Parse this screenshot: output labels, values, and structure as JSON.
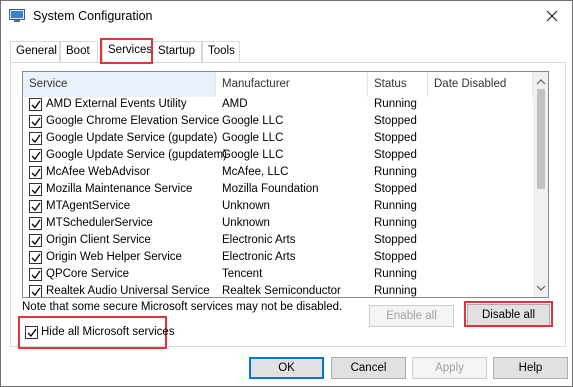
{
  "window": {
    "title": "System Configuration"
  },
  "tabs": [
    "General",
    "Boot",
    "Services",
    "Startup",
    "Tools"
  ],
  "active_tab": "Services",
  "table": {
    "columns": [
      "Service",
      "Manufacturer",
      "Status",
      "Date Disabled"
    ],
    "rows": [
      {
        "service": "AMD External Events Utility",
        "manufacturer": "AMD",
        "status": "Running",
        "checked": true
      },
      {
        "service": "Google Chrome Elevation Service",
        "manufacturer": "Google LLC",
        "status": "Stopped",
        "checked": true
      },
      {
        "service": "Google Update Service (gupdate)",
        "manufacturer": "Google LLC",
        "status": "Stopped",
        "checked": true
      },
      {
        "service": "Google Update Service (gupdatem)",
        "manufacturer": "Google LLC",
        "status": "Stopped",
        "checked": true
      },
      {
        "service": "McAfee WebAdvisor",
        "manufacturer": "McAfee, LLC",
        "status": "Running",
        "checked": true
      },
      {
        "service": "Mozilla Maintenance Service",
        "manufacturer": "Mozilla Foundation",
        "status": "Stopped",
        "checked": true
      },
      {
        "service": "MTAgentService",
        "manufacturer": "Unknown",
        "status": "Running",
        "checked": true
      },
      {
        "service": "MTSchedulerService",
        "manufacturer": "Unknown",
        "status": "Running",
        "checked": true
      },
      {
        "service": "Origin Client Service",
        "manufacturer": "Electronic Arts",
        "status": "Stopped",
        "checked": true
      },
      {
        "service": "Origin Web Helper Service",
        "manufacturer": "Electronic Arts",
        "status": "Stopped",
        "checked": true
      },
      {
        "service": "QPCore Service",
        "manufacturer": "Tencent",
        "status": "Running",
        "checked": true
      },
      {
        "service": "Realtek Audio Universal Service",
        "manufacturer": "Realtek Semiconductor",
        "status": "Running",
        "checked": true
      }
    ]
  },
  "note": "Note that some secure Microsoft services may not be disabled.",
  "buttons": {
    "enable_all": "Enable all",
    "disable_all": "Disable all",
    "ok": "OK",
    "cancel": "Cancel",
    "apply": "Apply",
    "help": "Help"
  },
  "hide_microsoft": {
    "label": "Hide all Microsoft services",
    "checked": true
  },
  "colors": {
    "highlight": "#e0343a",
    "header_selected": "#eaf1fb",
    "default_button_border": "#0078d7"
  },
  "icons": [
    "msconfig-app-icon",
    "close-icon",
    "checkbox-checked-icon",
    "scroll-up-icon",
    "scroll-down-icon"
  ]
}
